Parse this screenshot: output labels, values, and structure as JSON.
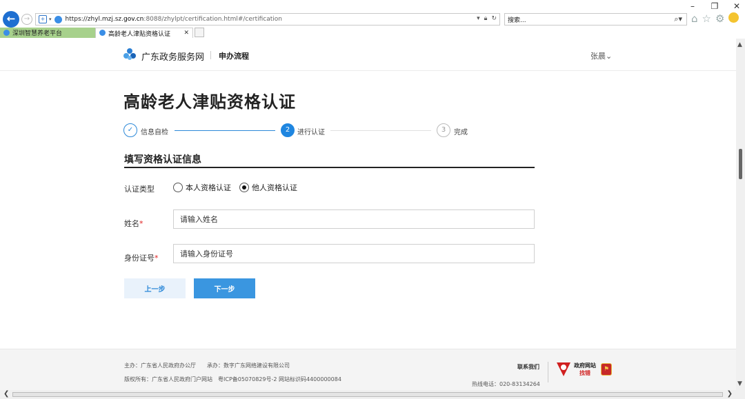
{
  "browser": {
    "url_host": "https://zhyl.mzj.sz.",
    "url_domain": "gov.cn",
    "url_path": ":8088/zhylpt/certification.html#/certification",
    "search_placeholder": "搜索...",
    "tabs": [
      {
        "label": "深圳智慧养老平台",
        "color": "#a7d18c"
      },
      {
        "label": "高龄老人津贴资格认证",
        "active": true
      }
    ],
    "window_controls": [
      "–",
      "❐",
      "✕"
    ]
  },
  "header": {
    "brand": "广东政务服务网",
    "nav_link": "申办流程",
    "user": "张晨⌄"
  },
  "page": {
    "title": "高龄老人津贴资格认证",
    "steps": [
      {
        "num": "✓",
        "label": "信息自检",
        "state": "done"
      },
      {
        "num": "2",
        "label": "进行认证",
        "state": "active"
      },
      {
        "num": "3",
        "label": "完成",
        "state": "pending"
      }
    ],
    "section_title": "填写资格认证信息",
    "form": {
      "type_label": "认证类型",
      "radio_self": "本人资格认证",
      "radio_other": "他人资格认证",
      "selected": "他人资格认证",
      "name_label": "姓名",
      "name_placeholder": "请输入姓名",
      "id_label": "身份证号",
      "id_placeholder": "请输入身份证号",
      "required_mark": "*"
    },
    "buttons": {
      "prev": "上一步",
      "next": "下一步"
    }
  },
  "footer": {
    "host": "主办：广东省人民政府办公厅　　承办：数字广东网络建设有限公司",
    "copyright": "版权所有：广东省人民政府门户网站　粤ICP备05070829号-2 网站标识码4400000084",
    "contact": "联系我们",
    "hotline": "热线电话：020-83134264",
    "badge_line1": "政府网站",
    "badge_line2": "找错"
  },
  "colors": {
    "accent": "#1f86e0",
    "button_next": "#3a96e0",
    "button_prev_bg": "#e9f2fb",
    "required": "#e02020"
  }
}
